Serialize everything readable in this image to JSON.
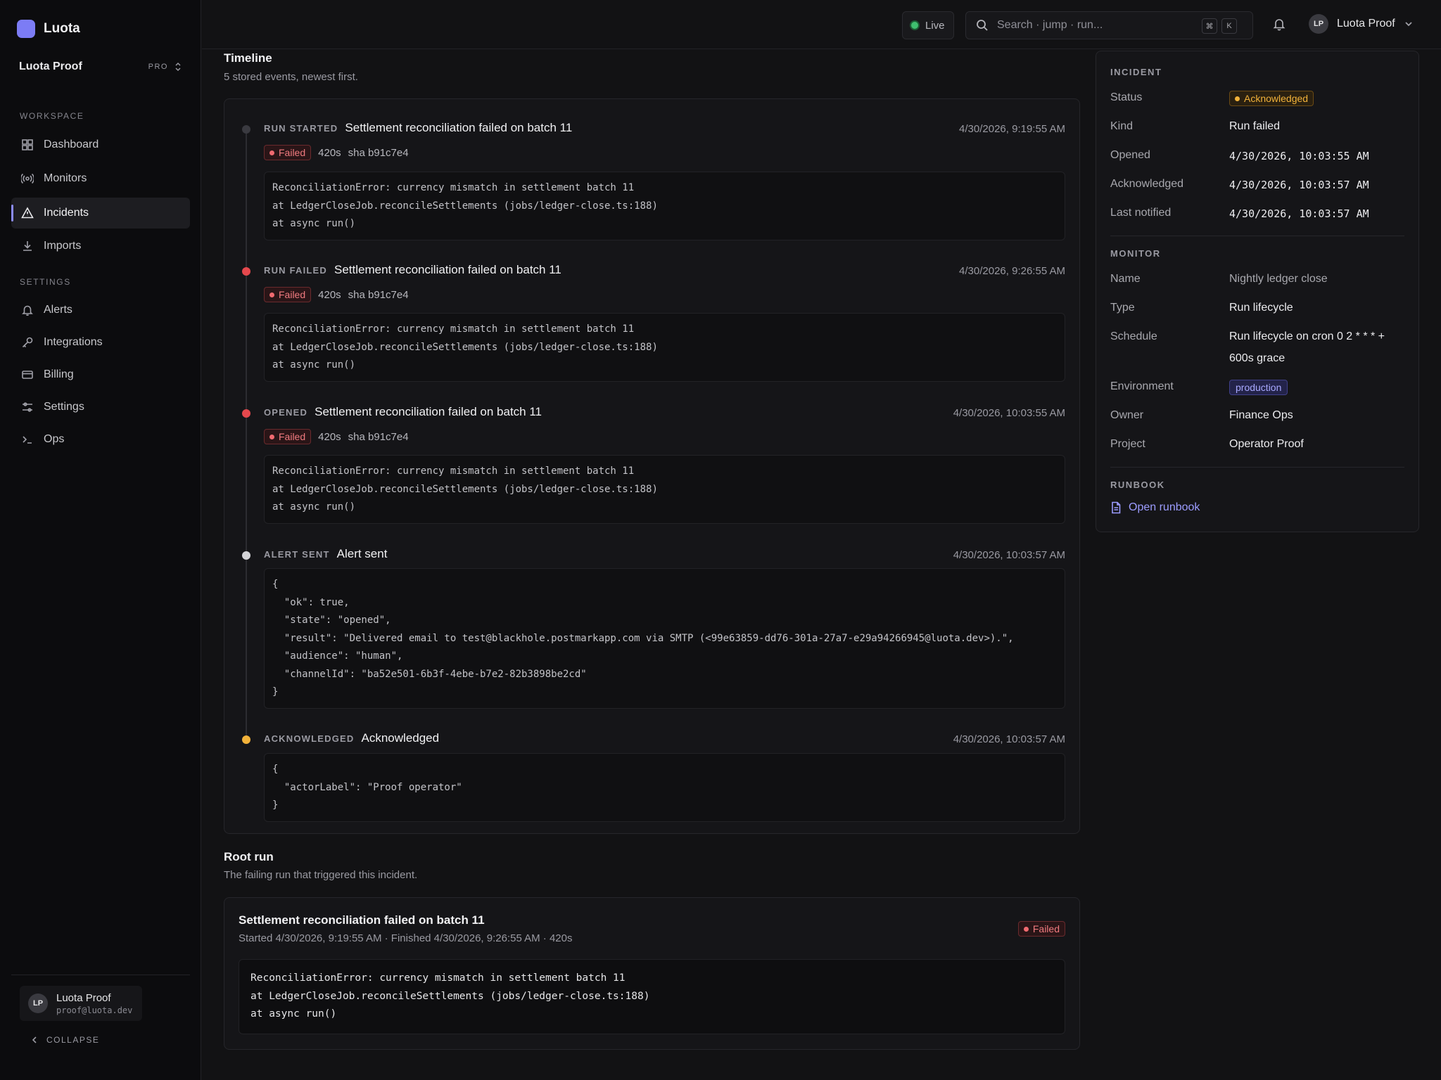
{
  "brand": {
    "name": "Luota"
  },
  "org": {
    "name": "Luota Proof",
    "plan": "PRO"
  },
  "nav": {
    "workspace_label": "WORKSPACE",
    "settings_label": "SETTINGS",
    "items": [
      {
        "label": "Dashboard",
        "icon": "grid-icon"
      },
      {
        "label": "Monitors",
        "icon": "broadcast-icon"
      },
      {
        "label": "Incidents",
        "icon": "alert-triangle-icon",
        "active": true
      },
      {
        "label": "Imports",
        "icon": "download-icon"
      },
      {
        "label": "Alerts",
        "icon": "bell-icon"
      },
      {
        "label": "Integrations",
        "icon": "key-icon"
      },
      {
        "label": "Billing",
        "icon": "credit-card-icon"
      },
      {
        "label": "Settings",
        "icon": "sliders-icon"
      },
      {
        "label": "Ops",
        "icon": "terminal-icon"
      }
    ]
  },
  "user": {
    "initials": "LP",
    "name": "Luota Proof",
    "email": "proof@luota.dev"
  },
  "collapse_label": "COLLAPSE",
  "topbar": {
    "live_label": "Live",
    "search_placeholder": "Search · jump · run...",
    "kbd_cmd": "⌘",
    "kbd_k": "K",
    "account_initials": "LP",
    "account_name": "Luota Proof"
  },
  "timeline": {
    "title": "Timeline",
    "subtitle": "5 stored events, newest first.",
    "events": [
      {
        "kind": "RUN STARTED",
        "title": "Settlement reconciliation failed on batch 11",
        "time": "4/30/2026, 9:19:55 AM",
        "status": "Failed",
        "duration": "420s",
        "sha": "sha b91c7e4",
        "dot_color": "#3a3a40",
        "code": "ReconciliationError: currency mismatch in settlement batch 11\nat LedgerCloseJob.reconcileSettlements (jobs/ledger-close.ts:188)\nat async run()"
      },
      {
        "kind": "RUN FAILED",
        "title": "Settlement reconciliation failed on batch 11",
        "time": "4/30/2026, 9:26:55 AM",
        "status": "Failed",
        "duration": "420s",
        "sha": "sha b91c7e4",
        "dot_color": "#e5484d",
        "code": "ReconciliationError: currency mismatch in settlement batch 11\nat LedgerCloseJob.reconcileSettlements (jobs/ledger-close.ts:188)\nat async run()"
      },
      {
        "kind": "OPENED",
        "title": "Settlement reconciliation failed on batch 11",
        "time": "4/30/2026, 10:03:55 AM",
        "status": "Failed",
        "duration": "420s",
        "sha": "sha b91c7e4",
        "dot_color": "#e5484d",
        "code": "ReconciliationError: currency mismatch in settlement batch 11\nat LedgerCloseJob.reconcileSettlements (jobs/ledger-close.ts:188)\nat async run()"
      },
      {
        "kind": "ALERT SENT",
        "title": "Alert sent",
        "time": "4/30/2026, 10:03:57 AM",
        "dot_color": "#d4d4d8",
        "code": "{\n  \"ok\": true,\n  \"state\": \"opened\",\n  \"result\": \"Delivered email to test@blackhole.postmarkapp.com via SMTP (<99e63859-dd76-301a-27a7-e29a94266945@luota.dev>).\",\n  \"audience\": \"human\",\n  \"channelId\": \"ba52e501-6b3f-4ebe-b7e2-82b3898be2cd\"\n}"
      },
      {
        "kind": "ACKNOWLEDGED",
        "title": "Acknowledged",
        "time": "4/30/2026, 10:03:57 AM",
        "dot_color": "#f2b23a",
        "code": "{\n  \"actorLabel\": \"Proof operator\"\n}"
      }
    ]
  },
  "root_run": {
    "title": "Root run",
    "subtitle": "The failing run that triggered this incident.",
    "run_title": "Settlement reconciliation failed on batch 11",
    "run_meta": "Started 4/30/2026, 9:19:55 AM · Finished 4/30/2026, 9:26:55 AM · 420s",
    "status": "Failed",
    "code": "ReconciliationError: currency mismatch in settlement batch 11\nat LedgerCloseJob.reconcileSettlements (jobs/ledger-close.ts:188)\nat async run()"
  },
  "incident": {
    "heading": "INCIDENT",
    "status_label": "Status",
    "status_value": "Acknowledged",
    "kind_label": "Kind",
    "kind_value": "Run failed",
    "opened_label": "Opened",
    "opened_value": "4/30/2026, 10:03:55 AM",
    "ack_label": "Acknowledged",
    "ack_value": "4/30/2026, 10:03:57 AM",
    "notified_label": "Last notified",
    "notified_value": "4/30/2026, 10:03:57 AM"
  },
  "monitor": {
    "heading": "MONITOR",
    "name_label": "Name",
    "name_value": "Nightly ledger close",
    "type_label": "Type",
    "type_value": "Run lifecycle",
    "schedule_label": "Schedule",
    "schedule_value_line1": "Run lifecycle on cron 0 2 * * * +",
    "schedule_value_line2": "600s grace",
    "env_label": "Environment",
    "env_value": "production",
    "owner_label": "Owner",
    "owner_value": "Finance Ops",
    "project_label": "Project",
    "project_value": "Operator Proof"
  },
  "runbook": {
    "heading": "RUNBOOK",
    "link_label": "Open runbook"
  },
  "colors": {
    "accent": "#8b8bf7",
    "failed": "#f06a70",
    "acknowledged": "#f2b23a",
    "live": "#3fbf6f"
  }
}
